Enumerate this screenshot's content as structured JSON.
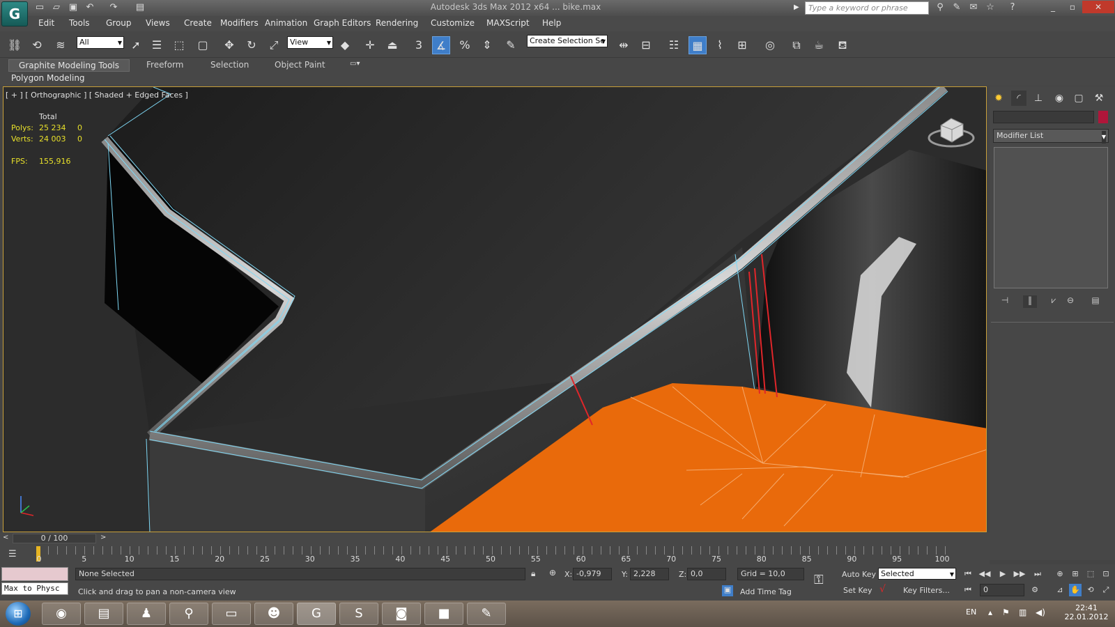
{
  "title_bar": {
    "title": "Autodesk 3ds Max 2012 x64 ... bike.max",
    "search_placeholder": "Type a keyword or phrase"
  },
  "menu": [
    "Edit",
    "Tools",
    "Group",
    "Views",
    "Create",
    "Modifiers",
    "Animation",
    "Graph Editors",
    "Rendering",
    "Customize",
    "MAXScript",
    "Help"
  ],
  "toolbar": {
    "selection_filter": "All",
    "ref_coord": "View",
    "snap_value": "3",
    "named_selection": "Create Selection Se"
  },
  "ribbon": {
    "tabs": [
      "Graphite Modeling Tools",
      "Freeform",
      "Selection",
      "Object Paint"
    ],
    "panel": "Polygon Modeling"
  },
  "viewport": {
    "label": "[ + ] [ Orthographic ] [ Shaded + Edged Faces ]",
    "stats": {
      "header": "Total",
      "polys_label": "Polys:",
      "polys_total": "25 234",
      "polys_sel": "0",
      "verts_label": "Verts:",
      "verts_total": "24 003",
      "verts_sel": "0",
      "fps_label": "FPS:",
      "fps": "155,916"
    },
    "colors": {
      "selection": "#e96a0b",
      "wire": "#6fd1f0",
      "edge_selected": "#e0262a"
    }
  },
  "command_panel": {
    "modifier_list": "Modifier List"
  },
  "timeline": {
    "frame": "0 / 100",
    "ticks": [
      "0",
      "5",
      "10",
      "15",
      "20",
      "25",
      "30",
      "35",
      "40",
      "45",
      "50",
      "55",
      "60",
      "65",
      "70",
      "75",
      "80",
      "85",
      "90",
      "95",
      "100"
    ]
  },
  "status": {
    "listener": "Max to Physc",
    "selection_info": "None Selected",
    "prompt": "Click and drag to pan a non-camera view",
    "x_label": "X:",
    "x": "-0,979",
    "y_label": "Y:",
    "y": "2,228",
    "z_label": "Z:",
    "z": "0,0",
    "grid": "Grid = 10,0",
    "add_time_tag": "Add Time Tag",
    "auto_key": "Auto Key",
    "set_key": "Set Key",
    "selected": "Selected",
    "key_filters": "Key Filters...",
    "current_frame": "0"
  },
  "taskbar": {
    "lang": "EN",
    "time": "22:41",
    "date": "22.01.2012"
  }
}
